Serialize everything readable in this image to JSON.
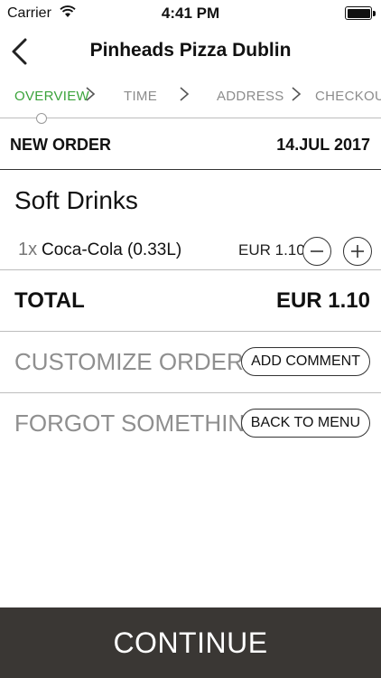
{
  "status_bar": {
    "carrier": "Carrier",
    "time": "4:41 PM"
  },
  "nav": {
    "title": "Pinheads Pizza Dublin"
  },
  "steps": [
    {
      "label": "OVERVIEW",
      "active": true
    },
    {
      "label": "TIME",
      "active": false
    },
    {
      "label": "ADDRESS",
      "active": false
    },
    {
      "label": "CHECKOUT",
      "active": false
    }
  ],
  "order": {
    "header_label": "NEW ORDER",
    "date": "14.JUL 2017"
  },
  "category": {
    "name": "Soft Drinks"
  },
  "item": {
    "qty": "1x",
    "name": "Coca-Cola (0.33L)",
    "price": "EUR 1.10"
  },
  "total": {
    "label": "TOTAL",
    "value": "EUR 1.10"
  },
  "customize": {
    "prompt": "CUSTOMIZE ORDER?",
    "button": "ADD COMMENT"
  },
  "forgot": {
    "prompt": "FORGOT SOMETHING?",
    "button": "BACK TO MENU"
  },
  "footer": {
    "continue": "CONTINUE"
  },
  "colors": {
    "active_step": "#3aa33a",
    "continue_bg": "#3a3734",
    "muted_text": "#8f8f8f"
  }
}
